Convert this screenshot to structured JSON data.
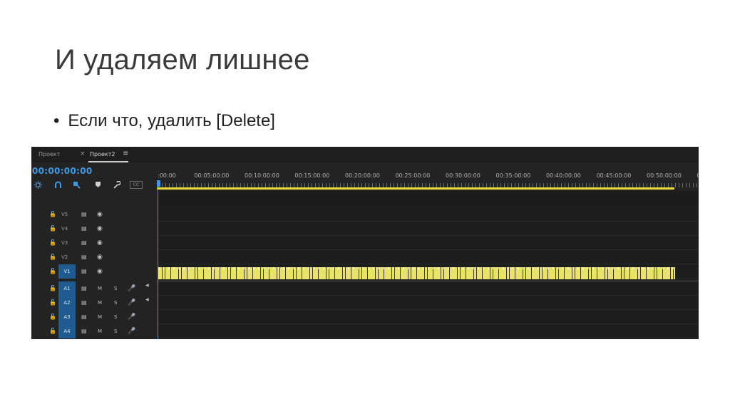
{
  "slide": {
    "title": "И удаляем лишнее",
    "bullet_symbol": "•",
    "bullet_text": "Если что, удалить [Delete]"
  },
  "panel": {
    "tabs": [
      {
        "label": "Проект"
      },
      {
        "label": "Проект2"
      }
    ],
    "close_glyph": "×",
    "menu_glyph": "≡",
    "timecode": "00:00:00:00",
    "tools": [
      {
        "icon": "snap-icon"
      },
      {
        "icon": "linked-selection-icon"
      },
      {
        "icon": "insert-sequence-icon"
      },
      {
        "icon": "marker-icon"
      },
      {
        "icon": "wrench-icon"
      },
      {
        "icon": "captions-icon",
        "label": "CC"
      }
    ],
    "ruler_labels": [
      ":00:00",
      "00:05:00:00",
      "00:10:00:00",
      "00:15:00:00",
      "00:20:00:00",
      "00:25:00:00",
      "00:30:00:00",
      "00:35:00:00",
      "00:40:00:00",
      "00:45:00:00",
      "00:50:00:00",
      "00"
    ],
    "video_tracks": [
      {
        "name": "V5"
      },
      {
        "name": "V4"
      },
      {
        "name": "V3"
      },
      {
        "name": "V2"
      },
      {
        "name": "V1",
        "patched": true
      }
    ],
    "audio_tracks": [
      {
        "name": "A1",
        "patched": true
      },
      {
        "name": "A2",
        "patched": true
      },
      {
        "name": "A3",
        "patched": true
      },
      {
        "name": "A4",
        "patched": true
      }
    ],
    "audio_mute_label": "M",
    "audio_solo_label": "S",
    "colors": {
      "timecode": "#3d9ae8",
      "clip": "#e9e36a",
      "work_area": "#e9dc3a",
      "patched_track": "#1f5b8f",
      "panel_bg": "#232323"
    }
  }
}
